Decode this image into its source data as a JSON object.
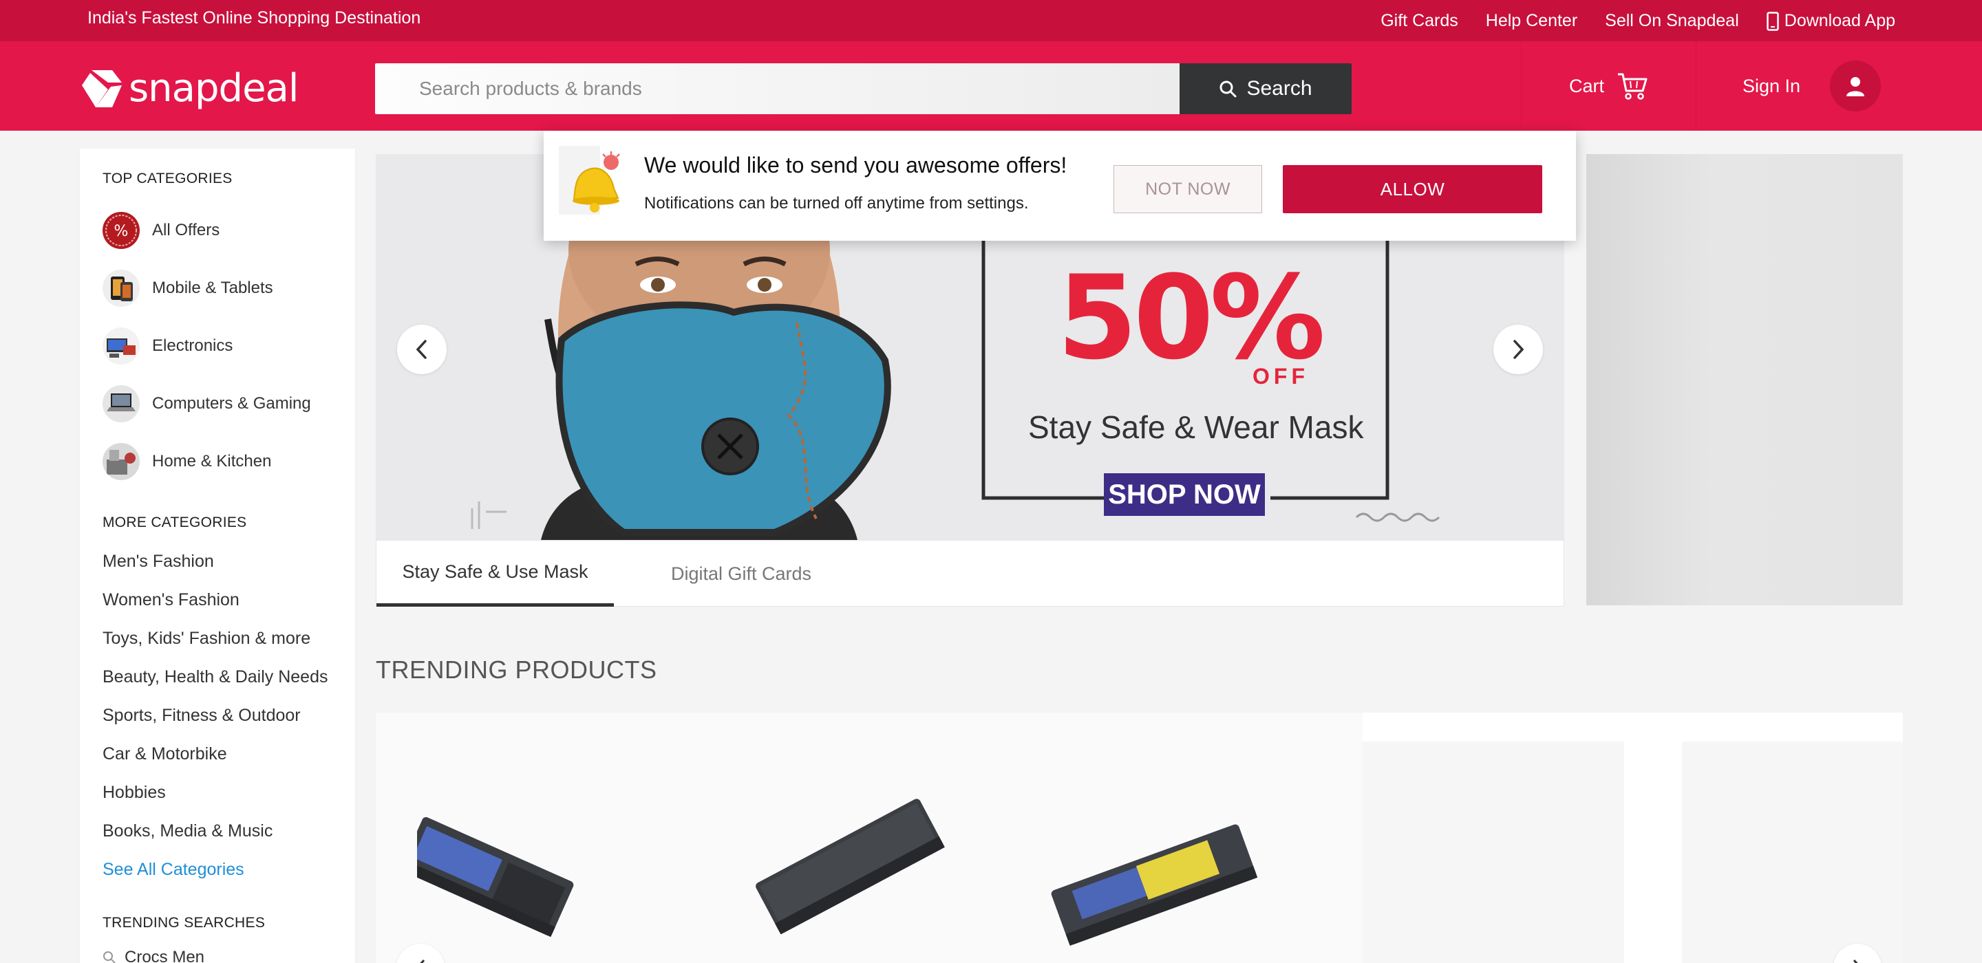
{
  "colors": {
    "topbar": "#c8103d",
    "header": "#e3174a",
    "accent": "#c8103d",
    "link": "#1f8fd8",
    "search_button": "#333436"
  },
  "topbar": {
    "tagline": "India's Fastest Online Shopping Destination",
    "links": [
      "Gift Cards",
      "Help Center",
      "Sell On Snapdeal"
    ],
    "download_app": "Download App"
  },
  "header": {
    "logo_text": "snapdeal",
    "search_placeholder": "Search products & brands",
    "search_button": "Search",
    "cart_label": "Cart",
    "signin_label": "Sign In"
  },
  "sidebar": {
    "top_title": "TOP CATEGORIES",
    "top_categories": [
      {
        "label": "All Offers",
        "icon": "percent-offer-icon"
      },
      {
        "label": "Mobile & Tablets",
        "icon": "mobile-icon"
      },
      {
        "label": "Electronics",
        "icon": "electronics-icon"
      },
      {
        "label": "Computers & Gaming",
        "icon": "laptop-icon"
      },
      {
        "label": "Home & Kitchen",
        "icon": "home-kitchen-icon"
      }
    ],
    "more_title": "MORE CATEGORIES",
    "more_categories": [
      "Men's Fashion",
      "Women's Fashion",
      "Toys, Kids' Fashion & more",
      "Beauty, Health & Daily Needs",
      "Sports, Fitness & Outdoor",
      "Car & Motorbike",
      "Hobbies",
      "Books, Media & Music"
    ],
    "see_all": "See All Categories",
    "trending_title": "TRENDING SEARCHES",
    "trending_searches": [
      "Crocs Men"
    ]
  },
  "banner": {
    "percent": "50%",
    "off": "OFF",
    "tagline": "Stay Safe & Wear Mask",
    "cta": "SHOP NOW",
    "tabs": [
      "Stay Safe & Use Mask",
      "Digital Gift Cards"
    ],
    "active_tab": 0
  },
  "trending": {
    "title": "TRENDING PRODUCTS"
  },
  "popup": {
    "title": "We would like to send you awesome offers!",
    "subtitle": "Notifications can be turned off anytime from settings.",
    "not_now": "NOT NOW",
    "allow": "ALLOW"
  }
}
